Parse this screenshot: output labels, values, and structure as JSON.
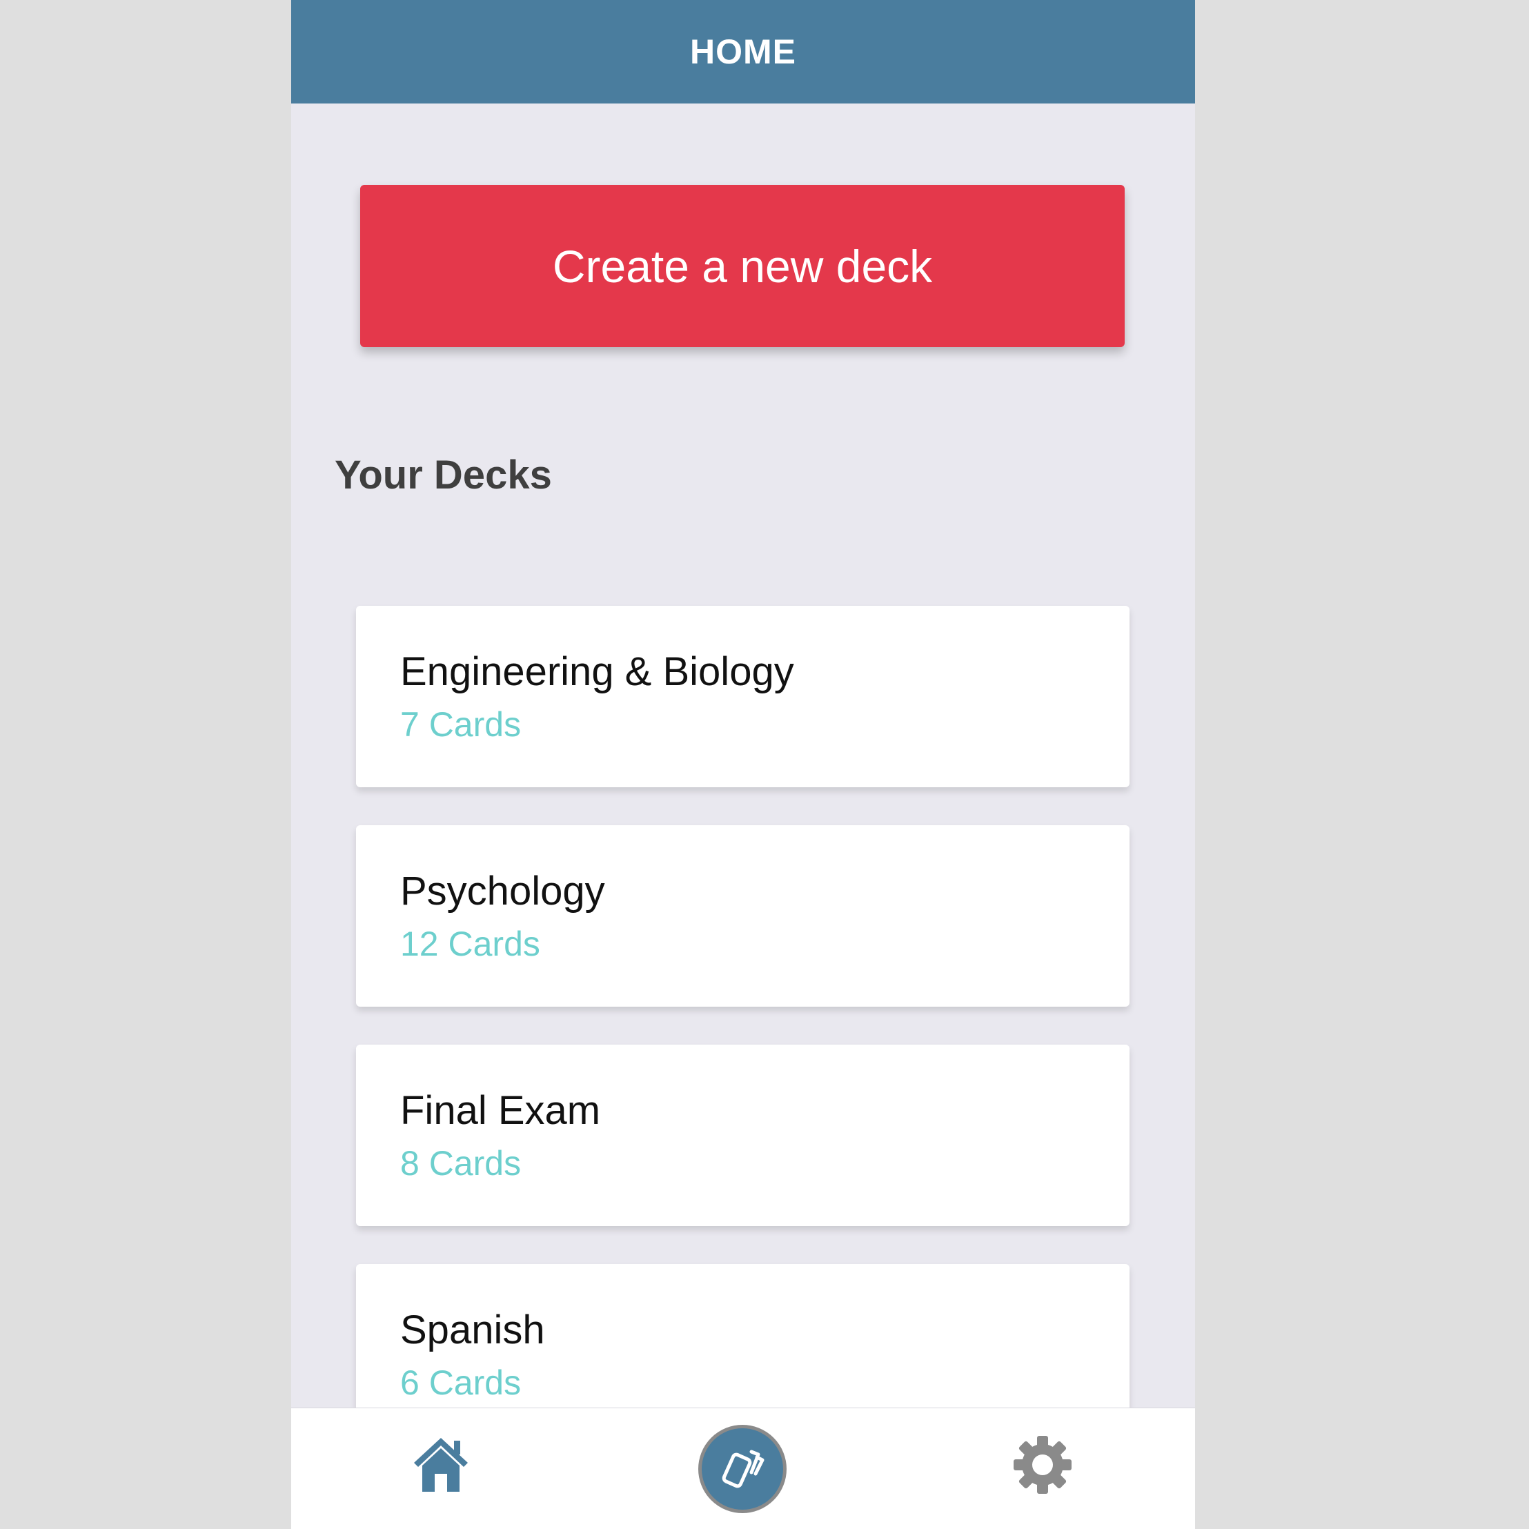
{
  "header": {
    "title": "HOME"
  },
  "actions": {
    "create_label": "Create a new deck"
  },
  "section": {
    "title": "Your Decks"
  },
  "decks": [
    {
      "name": "Engineering & Biology",
      "count": "7 Cards"
    },
    {
      "name": "Psychology",
      "count": "12 Cards"
    },
    {
      "name": "Final Exam",
      "count": "8 Cards"
    },
    {
      "name": "Spanish",
      "count": "6 Cards"
    }
  ],
  "tabbar": {
    "items": [
      {
        "icon": "home-icon",
        "active": true
      },
      {
        "icon": "cards-icon"
      },
      {
        "icon": "gear-icon"
      }
    ]
  },
  "colors": {
    "header": "#4a7d9e",
    "accent": "#e4384b",
    "card_count": "#6dcfcd",
    "background": "#e9e8ef"
  }
}
